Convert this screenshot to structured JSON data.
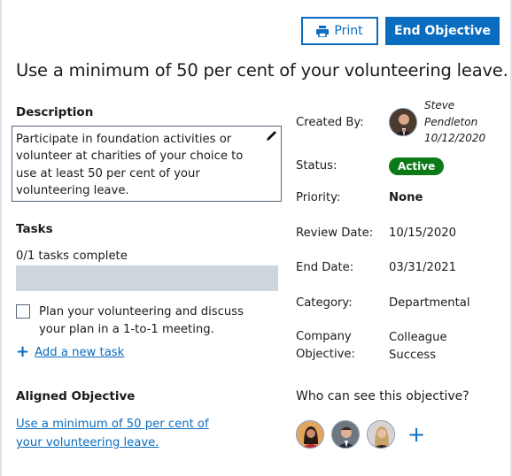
{
  "toolbar": {
    "print_label": "Print",
    "end_objective_label": "End Objective"
  },
  "objective": {
    "title": "Use a minimum of 50 per cent of your volunteering leave."
  },
  "description": {
    "label": "Description",
    "text": "Participate in foundation activities or volunteer at charities of your choice to use at least 50 per cent of your volunteering leave."
  },
  "tasks": {
    "label": "Tasks",
    "completed_count_text": "0/1 tasks complete",
    "progress": 0,
    "items": [
      {
        "label": "Plan your volunteering and discuss your plan in a 1-to-1 meeting.",
        "checked": false
      }
    ],
    "add_label": "Add a new task"
  },
  "aligned": {
    "label": "Aligned Objective",
    "link_text": "Use a minimum of 50 per cent of your volunteering leave."
  },
  "details": {
    "created_by_label": "Created By:",
    "creator_first": "Steve",
    "creator_last": "Pendleton",
    "created_date": "10/12/2020",
    "status_label": "Status:",
    "status_value": "Active",
    "priority_label": "Priority:",
    "priority_value": "None",
    "review_date_label": "Review Date:",
    "review_date_value": "10/15/2020",
    "end_date_label": "End Date:",
    "end_date_value": "03/31/2021",
    "category_label": "Category:",
    "category_value": "Departmental",
    "company_objective_label_1": "Company",
    "company_objective_label_2": "Objective:",
    "company_objective_value_1": "Colleague",
    "company_objective_value_2": "Success"
  },
  "visibility": {
    "label": "Who can see this objective?",
    "viewers": [
      "viewer-1",
      "viewer-2",
      "viewer-3"
    ]
  },
  "colors": {
    "primary": "#0a6cbf",
    "status_active": "#0b7a17",
    "progress_track": "#ced5dc"
  }
}
